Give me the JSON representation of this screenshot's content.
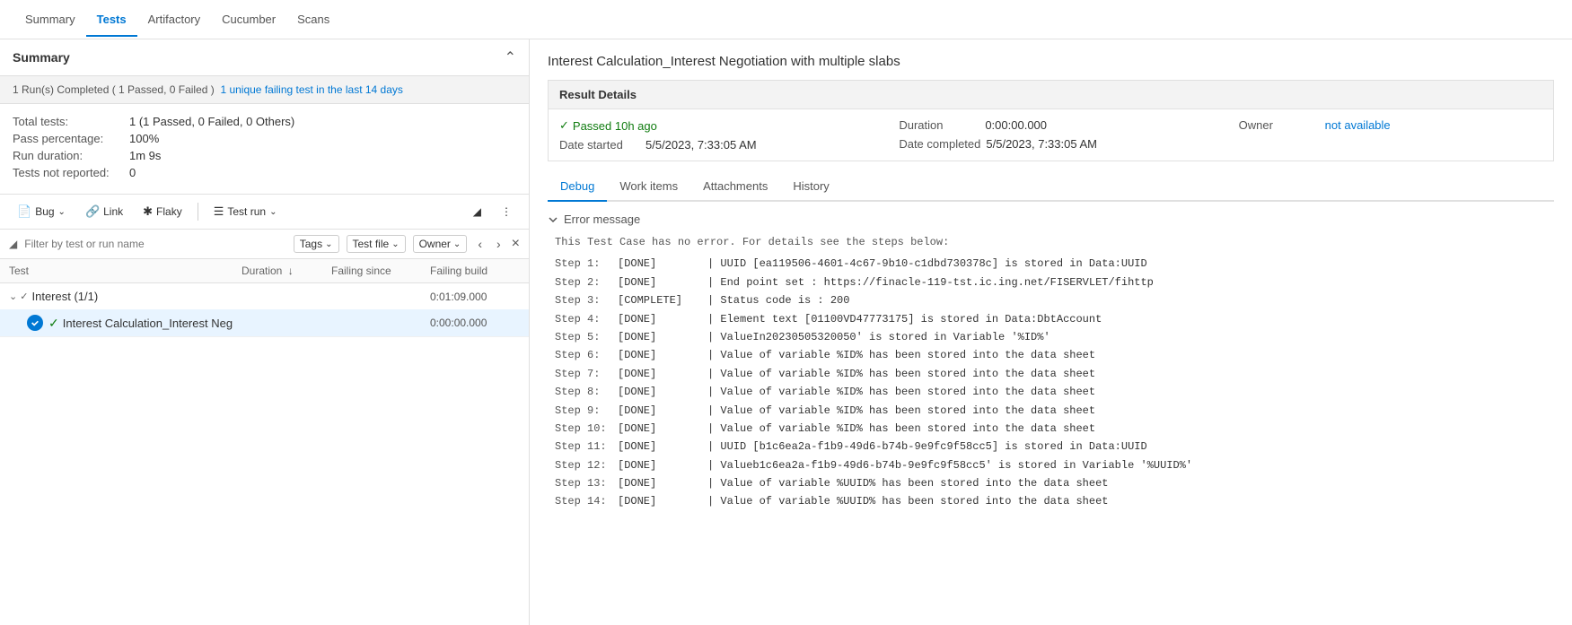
{
  "nav": {
    "items": [
      "Summary",
      "Tests",
      "Artifactory",
      "Cucumber",
      "Scans"
    ],
    "active": "Tests"
  },
  "left": {
    "summary": {
      "title": "Summary",
      "info_bar": "1 Run(s) Completed ( 1 Passed, 0 Failed )",
      "info_link": "1 unique failing test in the last 14 days",
      "stats": [
        {
          "label": "Total tests:",
          "value": "1 (1 Passed, 0 Failed, 0 Others)"
        },
        {
          "label": "Pass percentage:",
          "value": "100%"
        },
        {
          "label": "Run duration:",
          "value": "1m 9s"
        },
        {
          "label": "Tests not reported:",
          "value": "0"
        }
      ]
    },
    "toolbar": {
      "bug_label": "Bug",
      "link_label": "Link",
      "flaky_label": "Flaky",
      "test_run_label": "Test run"
    },
    "filter": {
      "placeholder": "Filter by test or run name",
      "tags_label": "Tags",
      "test_file_label": "Test file",
      "owner_label": "Owner"
    },
    "table_headers": {
      "test": "Test",
      "duration": "Duration",
      "failing_since": "Failing since",
      "failing_build": "Failing build"
    },
    "test_groups": [
      {
        "name": "Interest (1/1)",
        "duration": "0:01:09.000",
        "tests": [
          {
            "name": "Interest Calculation_Interest Neg",
            "full_name": "Interest Calculation_Interest Negotiation with multiple slabs",
            "duration": "0:00:00.000",
            "status": "passed",
            "selected": true
          }
        ]
      }
    ]
  },
  "right": {
    "title": "Interest Calculation_Interest Negotiation with multiple slabs",
    "result_details_label": "Result Details",
    "passed_label": "✓ Passed 10h ago",
    "duration_label": "Duration",
    "duration_value": "0:00:00.000",
    "owner_label": "Owner",
    "owner_value": "not available",
    "date_started_label": "Date started",
    "date_started_value": "5/5/2023, 7:33:05 AM",
    "date_completed_label": "Date completed",
    "date_completed_value": "5/5/2023, 7:33:05 AM",
    "tabs": [
      "Debug",
      "Work items",
      "Attachments",
      "History"
    ],
    "active_tab": "Debug",
    "error_section_label": "Error message",
    "steps": {
      "header": "This Test Case has no error. For details see the steps below:",
      "lines": [
        {
          "num": "Step 1:",
          "status": "[DONE]",
          "desc": "| UUID [ea119506-4601-4c67-9b10-c1dbd730378c] is stored in Data:UUID"
        },
        {
          "num": "Step 2:",
          "status": "[DONE]",
          "desc": "| End point set : https://finacle-119-tst.ic.ing.net/FISERVLET/fihttp"
        },
        {
          "num": "Step 3:",
          "status": "[COMPLETE]",
          "desc": "| Status code is : 200"
        },
        {
          "num": "Step 4:",
          "status": "[DONE]",
          "desc": "| Element text [01100VD47773175] is stored in Data:DbtAccount"
        },
        {
          "num": "Step 5:",
          "status": "[DONE]",
          "desc": "| ValueIn20230505320050' is stored in Variable '%ID%'"
        },
        {
          "num": "Step 6:",
          "status": "[DONE]",
          "desc": "| Value of variable %ID% has been stored into the data sheet"
        },
        {
          "num": "Step 7:",
          "status": "[DONE]",
          "desc": "| Value of variable %ID% has been stored into the data sheet"
        },
        {
          "num": "Step 8:",
          "status": "[DONE]",
          "desc": "| Value of variable %ID% has been stored into the data sheet"
        },
        {
          "num": "Step 9:",
          "status": "[DONE]",
          "desc": "| Value of variable %ID% has been stored into the data sheet"
        },
        {
          "num": "Step 10:",
          "status": "[DONE]",
          "desc": "| Value of variable %ID% has been stored into the data sheet"
        },
        {
          "num": "Step 11:",
          "status": "[DONE]",
          "desc": "| UUID [b1c6ea2a-f1b9-49d6-b74b-9e9fc9f58cc5] is stored in Data:UUID"
        },
        {
          "num": "Step 12:",
          "status": "[DONE]",
          "desc": "| Valueb1c6ea2a-f1b9-49d6-b74b-9e9fc9f58cc5' is stored in Variable '%UUID%'"
        },
        {
          "num": "Step 13:",
          "status": "[DONE]",
          "desc": "| Value of variable %UUID% has been stored into the data sheet"
        },
        {
          "num": "Step 14:",
          "status": "[DONE]",
          "desc": "| Value of variable %UUID% has been stored into the data sheet"
        }
      ]
    }
  }
}
